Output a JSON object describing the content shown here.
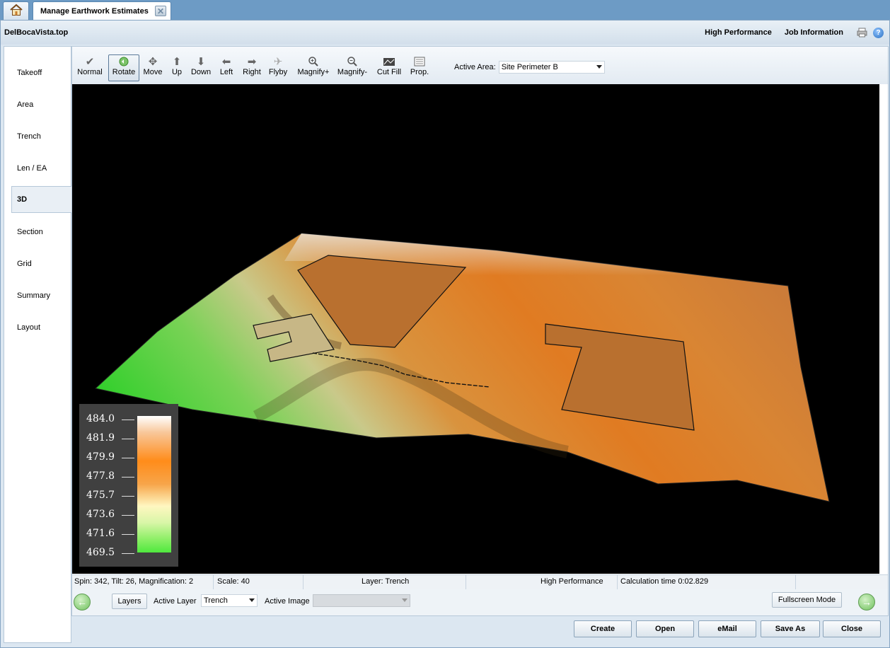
{
  "tabs": {
    "doc_tab": "Manage Earthwork Estimates"
  },
  "header": {
    "file_name": "DelBocaVista.top",
    "high_performance": "High Performance",
    "job_information": "Job Information"
  },
  "sidebar": {
    "items": [
      {
        "label": "Takeoff"
      },
      {
        "label": "Area"
      },
      {
        "label": "Trench"
      },
      {
        "label": "Len / EA"
      },
      {
        "label": "3D"
      },
      {
        "label": "Section"
      },
      {
        "label": "Grid"
      },
      {
        "label": "Summary"
      },
      {
        "label": "Layout"
      }
    ],
    "active": "3D"
  },
  "toolbar": {
    "tools": [
      {
        "label": "Normal",
        "icon": "checkmark-icon"
      },
      {
        "label": "Rotate",
        "icon": "rotate-icon"
      },
      {
        "label": "Move",
        "icon": "move-icon"
      },
      {
        "label": "Up",
        "icon": "arrow-up-icon"
      },
      {
        "label": "Down",
        "icon": "arrow-down-icon"
      },
      {
        "label": "Left",
        "icon": "arrow-left-icon"
      },
      {
        "label": "Right",
        "icon": "arrow-right-icon"
      },
      {
        "label": "Flyby",
        "icon": "flyby-icon"
      },
      {
        "label": "Magnify+",
        "icon": "zoom-in-icon"
      },
      {
        "label": "Magnify-",
        "icon": "zoom-out-icon"
      },
      {
        "label": "Cut Fill",
        "icon": "cut-fill-icon"
      },
      {
        "label": "Prop.",
        "icon": "properties-icon"
      }
    ],
    "active_tool": "Rotate",
    "active_area_label": "Active Area:",
    "active_area_value": "Site Perimeter B"
  },
  "legend": {
    "values": [
      "484.0",
      "481.9",
      "479.9",
      "477.8",
      "475.7",
      "473.6",
      "471.6",
      "469.5"
    ]
  },
  "status": {
    "view": "Spin: 342, Tilt: 26, Magnification: 2",
    "scale": "Scale:  40",
    "layer": "Layer: Trench",
    "performance": "High Performance",
    "calc_time": "Calculation time  0:02.829"
  },
  "bottom": {
    "layers_button": "Layers",
    "active_layer_label": "Active Layer",
    "active_layer_value": "Trench",
    "active_image_label": "Active Image",
    "active_image_value": "",
    "fullscreen_button": "Fullscreen Mode"
  },
  "footer": {
    "buttons": [
      "Create",
      "Open",
      "eMail",
      "Save As",
      "Close"
    ]
  },
  "colors": {
    "accent": "#6d9bc5",
    "terrain_high": "#ff8c1a",
    "terrain_low": "#4fe83e"
  }
}
